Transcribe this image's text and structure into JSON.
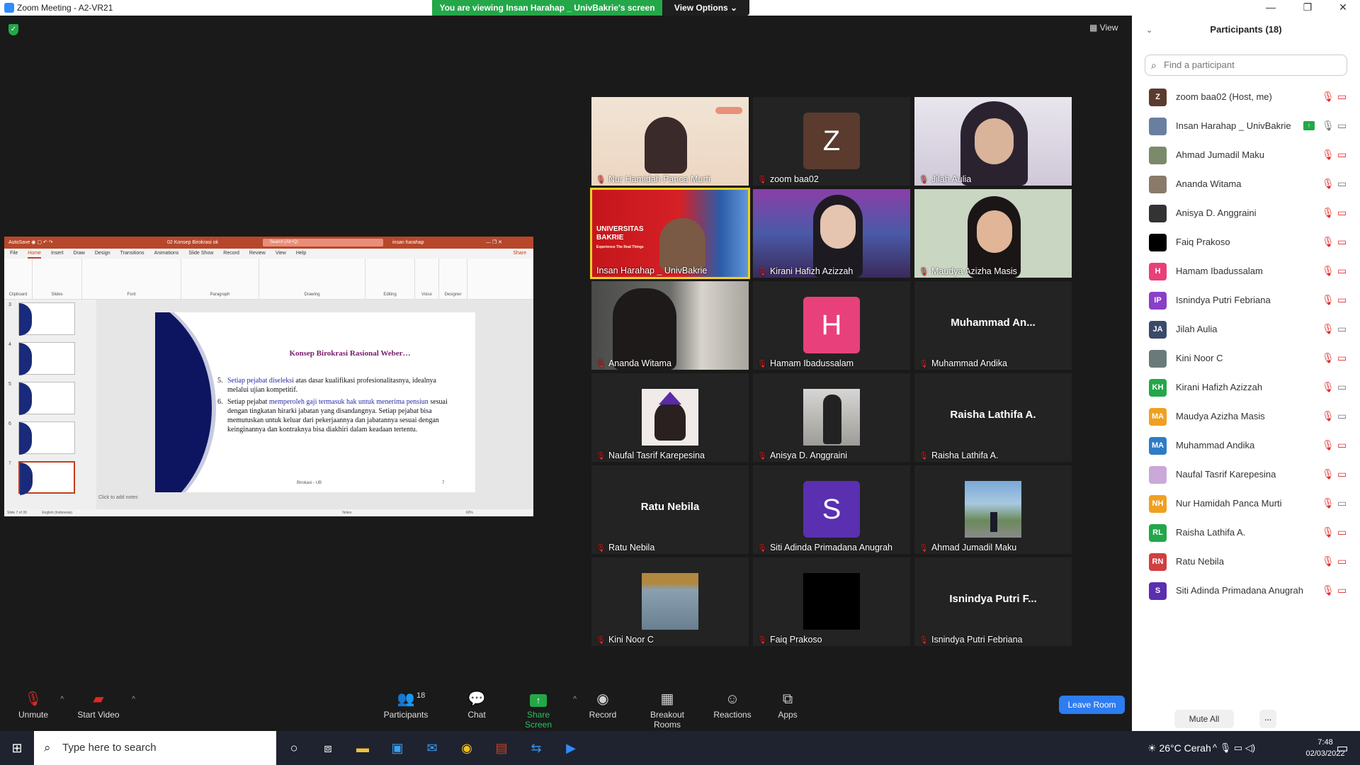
{
  "window": {
    "title": "Zoom Meeting - A2-VR21",
    "banner": "You are viewing Insan Harahap _ UnivBakrie's screen",
    "view_options": "View Options ⌄",
    "view_label": "View"
  },
  "shared_screen": {
    "ppt_title": "02 Konsep Birokrasi ok",
    "ppt_search": "Search (Alt+Q)",
    "ppt_user": "insan harahap",
    "tabs": [
      "File",
      "Home",
      "Insert",
      "Draw",
      "Design",
      "Transitions",
      "Animations",
      "Slide Show",
      "Record",
      "Review",
      "View",
      "Help"
    ],
    "share": "Share",
    "ribbon_groups": [
      "Clipboard",
      "Slides",
      "Font",
      "Paragraph",
      "Drawing",
      "Editing",
      "Voice",
      "Designer"
    ],
    "thumb_numbers": [
      "3",
      "4",
      "5",
      "6",
      "7"
    ],
    "slide_title": "Konsep Birokrasi Rasional Weber…",
    "item5_num": "5.",
    "item5_hl": "Setiap pejabat diseleksi",
    "item5_rest": " atas dasar kualifikasi profesionalitasnya, idealnya melalui ujian kompetitif.",
    "item6_num": "6.",
    "item6_a": "Setiap pejabat ",
    "item6_hl": "memperoleh gaji termasuk hak untuk menerima pensiun",
    "item6_rest": " sesuai dengan tingkatan hirarki jabatan yang disandangnya. Setiap pejabat bisa memutuskan untuk keluar dari pekerjaannya dan jabatannya sesuai dengan keinginannya dan kontraknya bisa diakhiri dalam keadaan tertentu.",
    "slide_footer": "Birokasi - UB",
    "slide_page": "7",
    "notes": "Click to add notes",
    "status_left": "Slide 7 of 39",
    "status_lang": "English (Indonesia)",
    "status_notes": "Notes",
    "zoom_level": "60%"
  },
  "tiles": [
    {
      "name": "Nur Hamidah Panca Murti"
    },
    {
      "name": "zoom baa02",
      "letter": "Z"
    },
    {
      "name": "Jilah Aulia"
    },
    {
      "name": "Insan Harahap _ UnivBakrie",
      "logo1": "UNIVERSITAS",
      "logo2": "BAKRIE",
      "logo3": "Experience The Real Things"
    },
    {
      "name": "Kirani Hafizh Azizzah"
    },
    {
      "name": "Maudya Azizha Masis"
    },
    {
      "name": "Ananda Witama"
    },
    {
      "name": "Hamam Ibadussalam",
      "letter": "H"
    },
    {
      "name": "Muhammad Andika",
      "big": "Muhammad  An..."
    },
    {
      "name": "Naufal Tasrif Karepesina"
    },
    {
      "name": "Anisya D. Anggraini"
    },
    {
      "name": "Raisha Lathifa A.",
      "big": "Raisha Lathifa A."
    },
    {
      "name": "Ratu Nebila",
      "big": "Ratu Nebila"
    },
    {
      "name": "Siti Adinda Primadana Anugrah",
      "letter": "S"
    },
    {
      "name": "Ahmad Jumadil Maku"
    },
    {
      "name": "Kini Noor C"
    },
    {
      "name": "Faiq Prakoso"
    },
    {
      "name": "Isnindya Putri Febriana",
      "big": "Isnindya  Putri  F..."
    }
  ],
  "panel": {
    "title": "Participants (18)",
    "search_placeholder": "Find a participant",
    "participants": [
      {
        "initials": "Z",
        "name": "zoom baa02 (Host, me)",
        "color": "#5a3b2e"
      },
      {
        "initials": "",
        "name": "Insan Harahap _ UnivBakrie",
        "color": "#6a7fa0"
      },
      {
        "initials": "",
        "name": "Ahmad Jumadil Maku",
        "color": "#7a8a6a"
      },
      {
        "initials": "",
        "name": "Ananda Witama",
        "color": "#8a7a6a"
      },
      {
        "initials": "",
        "name": "Anisya D. Anggraini",
        "color": "#333333"
      },
      {
        "initials": "",
        "name": "Faiq Prakoso",
        "color": "#000000"
      },
      {
        "initials": "H",
        "name": "Hamam Ibadussalam",
        "color": "#e8407a"
      },
      {
        "initials": "IP",
        "name": "Isnindya Putri Febriana",
        "color": "#8a3fc7"
      },
      {
        "initials": "JA",
        "name": "Jilah Aulia",
        "color": "#3a4a6a"
      },
      {
        "initials": "",
        "name": "Kini Noor C",
        "color": "#6a7a7a"
      },
      {
        "initials": "KH",
        "name": "Kirani Hafizh Azizzah",
        "color": "#23a749"
      },
      {
        "initials": "MA",
        "name": "Maudya Azizha Masis",
        "color": "#f0a020"
      },
      {
        "initials": "MA",
        "name": "Muhammad Andika",
        "color": "#2d7cc7"
      },
      {
        "initials": "",
        "name": "Naufal Tasrif Karepesina",
        "color": "#caa8d8"
      },
      {
        "initials": "NH",
        "name": "Nur Hamidah Panca Murti",
        "color": "#f0a020"
      },
      {
        "initials": "RL",
        "name": "Raisha Lathifa A.",
        "color": "#23a749"
      },
      {
        "initials": "RN",
        "name": "Ratu Nebila",
        "color": "#d04040"
      },
      {
        "initials": "S",
        "name": "Siti Adinda Primadana Anugrah",
        "color": "#5a2fb0"
      }
    ],
    "mute_all": "Mute All",
    "more": "..."
  },
  "toolbar": {
    "unmute": "Unmute",
    "start_video": "Start Video",
    "participants": "Participants",
    "participants_count": "18",
    "chat": "Chat",
    "share_screen": "Share Screen",
    "record": "Record",
    "breakout": "Breakout Rooms",
    "reactions": "Reactions",
    "apps": "Apps",
    "leave": "Leave Room"
  },
  "taskbar": {
    "search": "Type here to search",
    "weather": "26°C  Cerah",
    "time": "7:48",
    "date": "02/03/2022"
  }
}
